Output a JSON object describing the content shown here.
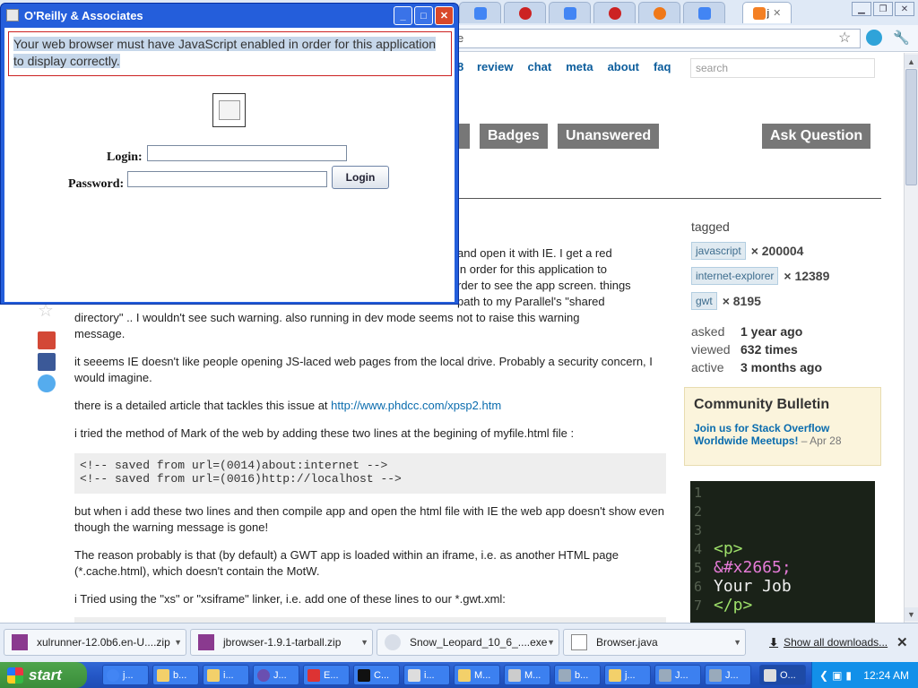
{
  "browser": {
    "active_tab_label": "j",
    "omnibox_text": "e",
    "tab_icon_colors": [
      "#4285f4",
      "#4285f4",
      "#cc2222",
      "#4285f4",
      "#cc2222",
      "#f07818",
      "#4285f4"
    ]
  },
  "page": {
    "nav_partial": "8",
    "nav": [
      "review",
      "chat",
      "meta",
      "about",
      "faq"
    ],
    "search_placeholder": "search",
    "buttons": {
      "badges": "Badges",
      "unanswered": "Unanswered",
      "ask": "Ask Question"
    },
    "question_lines": [
      "and open it with IE. I get a red",
      "in order for this application to",
      "rder to see the app screen. things",
      "path to my Parallel's \"shared",
      "directory\" .. I wouldn't see such warning. also running in dev mode seems not to raise this warning",
      "message."
    ],
    "para2": "it seeems IE doesn't like people opening JS-laced web pages from the local drive. Probably a security concern, I would imagine.",
    "para3_prefix": "there is a detailed article that tackles this issue at ",
    "para3_link": "http://www.phdcc.com/xpsp2.htm",
    "para4": "i tried the method of Mark of the web by adding these two lines at the begining of myfile.html file :",
    "code_lines": [
      "<!-- saved from url=(0014)about:internet -->",
      "<!-- saved from url=(0016)http://localhost -->"
    ],
    "para5": "but when i add these two lines and then compile app and open the html file with IE the web app doesn't show even though the warning message is gone!",
    "para6": "The reason probably is that (by default) a GWT app is loaded within an iframe, i.e. as another HTML page (*.cache.html), which doesn't contain the MotW.",
    "para7": "i Tried using the \"xs\" or \"xsiframe\" linker, i.e. add one of these lines to our *.gwt.xml:"
  },
  "sidebar": {
    "tagged_label": "tagged",
    "tags": [
      {
        "name": "javascript",
        "count": "× 200004"
      },
      {
        "name": "internet-explorer",
        "count": "× 12389"
      },
      {
        "name": "gwt",
        "count": "× 8195"
      }
    ],
    "stats": [
      {
        "key": "asked",
        "value": "1 year ago"
      },
      {
        "key": "viewed",
        "value": "632 times"
      },
      {
        "key": "active",
        "value": "3 months ago"
      }
    ],
    "bulletin_title": "Community Bulletin",
    "bulletin_link": "Join us for Stack Overflow Worldwide Meetups!",
    "bulletin_date": "– Apr 28",
    "ad_lines": [
      {
        "n": "1",
        "code": ""
      },
      {
        "n": "2",
        "code": ""
      },
      {
        "n": "3",
        "code": ""
      },
      {
        "n": "4",
        "code": "<p>"
      },
      {
        "n": "5",
        "code": "&#x2665;"
      },
      {
        "n": "6",
        "code": "Your Job"
      },
      {
        "n": "7",
        "code": "</p>"
      }
    ]
  },
  "popup": {
    "title": "O'Reilly & Associates",
    "warning": "Your web browser must have JavaScript enabled in order for this application to display correctly.",
    "login_label": "Login:",
    "password_label": "Password:",
    "login_button": "Login",
    "min": "_",
    "max": "□",
    "close": "✕"
  },
  "downloads": {
    "items": [
      "xulrunner-12.0b6.en-U....zip",
      "jbrowser-1.9.1-tarball.zip",
      "Snow_Leopard_10_6_....exe",
      "Browser.java"
    ],
    "show_all": "Show all downloads..."
  },
  "taskbar": {
    "start": "start",
    "buttons": [
      "j...",
      "b...",
      "i...",
      "J...",
      "E...",
      "C...",
      "i...",
      "M...",
      "M...",
      "b...",
      "j...",
      "J...",
      "J...",
      "O..."
    ],
    "clock": "12:24 AM"
  }
}
